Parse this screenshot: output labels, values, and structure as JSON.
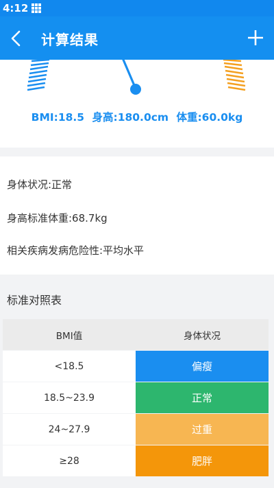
{
  "status_bar": {
    "time": "4:12"
  },
  "app_bar": {
    "title": "计算结果"
  },
  "result": {
    "bmi_text": "BMI:18.5",
    "height_text": "身高:180.0cm",
    "weight_text": "体重:60.0kg",
    "colors": {
      "accent": "#148ff0",
      "left_scale": "#1a8ef0",
      "right_scale": "#f4a020",
      "needle": "#1a8ef0"
    }
  },
  "info": {
    "status": "身体状况:正常",
    "standard_weight": "身高标准体重:68.7kg",
    "risk": "相关疾病发病危险性:平均水平"
  },
  "table": {
    "title": "标准对照表",
    "headers": [
      "BMI值",
      "身体状况"
    ],
    "rows": [
      {
        "range": "<18.5",
        "status": "偏瘦",
        "color": "#1a8ef0"
      },
      {
        "range": "18.5~23.9",
        "status": "正常",
        "color": "#2db66e"
      },
      {
        "range": "24~27.9",
        "status": "过重",
        "color": "#f7b652"
      },
      {
        "range": "≥28",
        "status": "肥胖",
        "color": "#f4960a"
      }
    ]
  }
}
